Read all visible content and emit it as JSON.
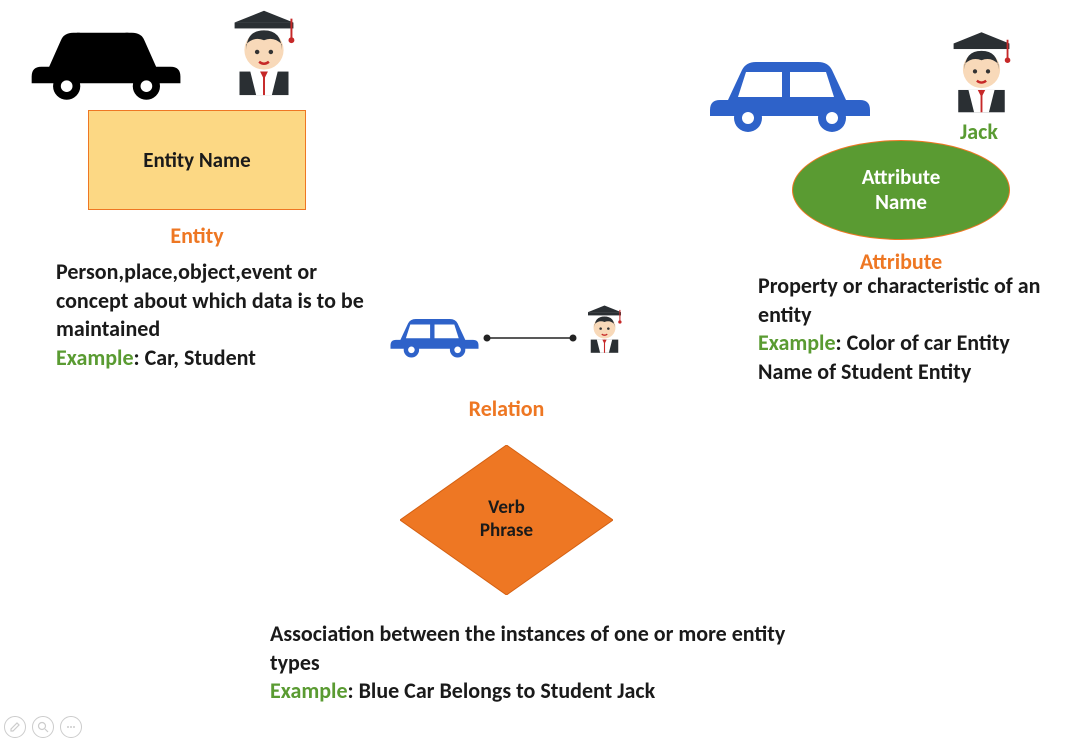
{
  "entity": {
    "box_label": "Entity Name",
    "section": "Entity",
    "desc": "Person,place,object,event or concept about which data is to be maintained",
    "example_prefix": "Example",
    "example": ": Car, Student"
  },
  "attribute": {
    "ellipse_label": "Attribute Name",
    "section": "Attribute",
    "jack": "Jack",
    "desc": "Property or characteristic of an entity",
    "example_prefix": "Example",
    "example": ": Color of car Entity Name of Student Entity"
  },
  "relation": {
    "diamond_label": "Verb Phrase",
    "section": "Relation",
    "desc": "Association between the instances of one or more entity types",
    "example_prefix": "Example",
    "example": ": Blue Car Belongs to Student Jack"
  },
  "icons": {
    "car_black": "black-car-icon",
    "car_blue": "blue-car-icon",
    "student": "student-icon",
    "pen": "pen-icon",
    "zoom": "zoom-icon",
    "more": "more-icon"
  }
}
